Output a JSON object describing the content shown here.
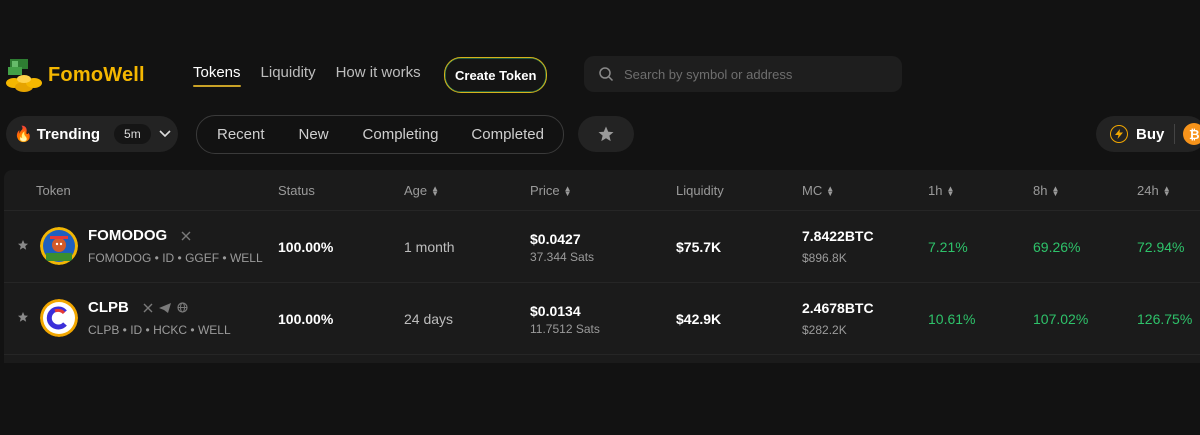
{
  "header": {
    "logo_text": "FomoWell",
    "nav": [
      {
        "label": "Tokens",
        "active": true
      },
      {
        "label": "Liquidity",
        "active": false
      },
      {
        "label": "How it works",
        "active": false
      }
    ],
    "create_token_label": "Create Token",
    "search_placeholder": "Search by symbol or address"
  },
  "filters": {
    "trending_label": "Trending",
    "interval": "5m",
    "tabs": [
      "Recent",
      "New",
      "Completing",
      "Completed"
    ],
    "buy_label": "Buy"
  },
  "table": {
    "columns": [
      "Token",
      "Status",
      "Age",
      "Price",
      "Liquidity",
      "MC",
      "1h",
      "8h",
      "24h"
    ],
    "rows": [
      {
        "name": "FOMODOG",
        "meta": "FOMODOG • ID • GGEF • WELL",
        "status": "100.00%",
        "age": "1 month",
        "price": "$0.0427",
        "price_sats": "37.344 Sats",
        "liquidity": "$75.7K",
        "mc_btc": "7.8422BTC",
        "mc_usd": "$896.8K",
        "change_1h": "7.21%",
        "change_8h": "69.26%",
        "change_24h": "72.94%"
      },
      {
        "name": "CLPB",
        "meta": "CLPB • ID • HCKC • WELL",
        "status": "100.00%",
        "age": "24 days",
        "price": "$0.0134",
        "price_sats": "11.7512 Sats",
        "liquidity": "$42.9K",
        "mc_btc": "2.4678BTC",
        "mc_usd": "$282.2K",
        "change_1h": "10.61%",
        "change_8h": "107.02%",
        "change_24h": "126.75%"
      }
    ]
  },
  "colors": {
    "accent_gold": "#f5b700",
    "positive": "#2ec26a",
    "bitcoin": "#f7931a"
  }
}
